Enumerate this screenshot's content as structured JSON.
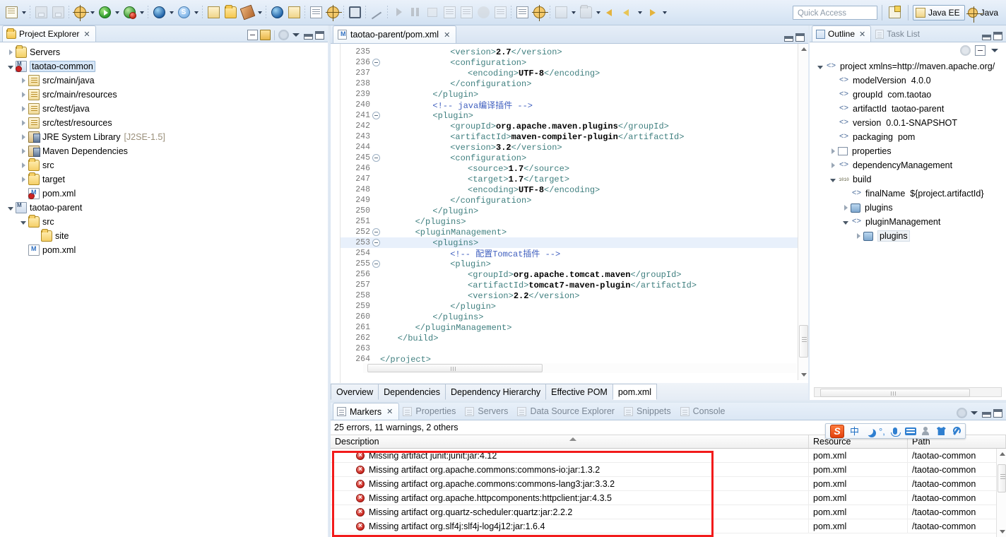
{
  "toolbar": {
    "quick_access_placeholder": "Quick Access",
    "perspectives": [
      {
        "label": "Java EE",
        "active": true
      },
      {
        "label": "Java",
        "active": false
      }
    ],
    "icons": [
      "new-wizard-icon",
      "new-wizard-dropdown",
      "save-icon",
      "save-all-icon",
      "debug-spider-icon",
      "debug-dropdown",
      "run-icon",
      "run-dropdown",
      "debug-bug-icon",
      "debug-bug-dropdown",
      "external-tools-icon",
      "external-tools-dropdown",
      "coverage-icon",
      "coverage-dropdown",
      "open-type-icon",
      "open-folder-icon",
      "brush-icon",
      "brush-dropdown",
      "web-browser-icon",
      "run-server-icon",
      "search-icon",
      "profile-icon",
      "terminal-icon",
      "toggle-breadcrumb-icon",
      "step-into-icon",
      "pause-icon",
      "stop-icon",
      "step-over-icon",
      "step-return-icon",
      "resume-icon",
      "drop-to-frame-icon",
      "next-annotation-icon",
      "previous-annotation-icon",
      "last-edit-icon",
      "last-edit-dropdown",
      "next-edit-icon",
      "next-edit-dropdown",
      "back-icon",
      "forward-icon",
      "forward-dropdown",
      "nav-forward-icon",
      "nav-forward-dropdown",
      "open-perspective-icon"
    ]
  },
  "project_explorer": {
    "title": "Project Explorer",
    "tools": [
      "collapse-all-icon",
      "link-with-editor-icon",
      "view-gear-icon",
      "view-menu-icon",
      "minimize-icon",
      "maximize-icon"
    ],
    "tree": [
      {
        "label": "Servers",
        "indent": 0,
        "twist": "closed",
        "icon": "server-folder-icon",
        "selected": false,
        "suffix": ""
      },
      {
        "label": "taotao-common",
        "indent": 0,
        "twist": "open",
        "icon": "maven-project-error-icon",
        "selected": true,
        "suffix": ""
      },
      {
        "label": "src/main/java",
        "indent": 1,
        "twist": "closed",
        "icon": "source-folder-icon",
        "selected": false,
        "suffix": ""
      },
      {
        "label": "src/main/resources",
        "indent": 1,
        "twist": "closed",
        "icon": "source-folder-icon",
        "selected": false,
        "suffix": ""
      },
      {
        "label": "src/test/java",
        "indent": 1,
        "twist": "closed",
        "icon": "source-folder-icon",
        "selected": false,
        "suffix": ""
      },
      {
        "label": "src/test/resources",
        "indent": 1,
        "twist": "closed",
        "icon": "source-folder-icon",
        "selected": false,
        "suffix": ""
      },
      {
        "label": "JRE System Library",
        "indent": 1,
        "twist": "closed",
        "icon": "jre-library-icon",
        "selected": false,
        "suffix": "[J2SE-1.5]"
      },
      {
        "label": "Maven Dependencies",
        "indent": 1,
        "twist": "closed",
        "icon": "jre-library-icon",
        "selected": false,
        "suffix": ""
      },
      {
        "label": "src",
        "indent": 1,
        "twist": "closed",
        "icon": "folder-icon",
        "selected": false,
        "suffix": ""
      },
      {
        "label": "target",
        "indent": 1,
        "twist": "closed",
        "icon": "folder-icon",
        "selected": false,
        "suffix": ""
      },
      {
        "label": "pom.xml",
        "indent": 1,
        "twist": "none",
        "icon": "pom-error-icon",
        "selected": false,
        "suffix": ""
      },
      {
        "label": "taotao-parent",
        "indent": 0,
        "twist": "open",
        "icon": "maven-project-icon",
        "selected": false,
        "suffix": ""
      },
      {
        "label": "src",
        "indent": 1,
        "twist": "open",
        "icon": "folder-icon",
        "selected": false,
        "suffix": ""
      },
      {
        "label": "site",
        "indent": 2,
        "twist": "none",
        "icon": "folder-icon",
        "selected": false,
        "suffix": ""
      },
      {
        "label": "pom.xml",
        "indent": 1,
        "twist": "none",
        "icon": "pom-icon",
        "selected": false,
        "suffix": ""
      }
    ]
  },
  "editor": {
    "tab_title": "taotao-parent/pom.xml",
    "tab_icon": "maven-pom-icon",
    "tools": [
      "minimize-icon",
      "maximize-icon"
    ],
    "bottom_tabs": [
      {
        "label": "Overview",
        "active": false
      },
      {
        "label": "Dependencies",
        "active": false
      },
      {
        "label": "Dependency Hierarchy",
        "active": false
      },
      {
        "label": "Effective POM",
        "active": false
      },
      {
        "label": "pom.xml",
        "active": true
      }
    ],
    "lines": [
      {
        "num": "235",
        "fold": false,
        "hl": false,
        "indent": 16,
        "text": "<version>2.7</version>"
      },
      {
        "num": "236",
        "fold": true,
        "hl": false,
        "indent": 16,
        "text": "<configuration>"
      },
      {
        "num": "237",
        "fold": false,
        "hl": false,
        "indent": 20,
        "text": "<encoding>UTF-8</encoding>"
      },
      {
        "num": "238",
        "fold": false,
        "hl": false,
        "indent": 16,
        "text": "</configuration>"
      },
      {
        "num": "239",
        "fold": false,
        "hl": false,
        "indent": 12,
        "text": "</plugin>"
      },
      {
        "num": "240",
        "fold": false,
        "hl": false,
        "indent": 12,
        "text": "<!-- java编译插件 -->"
      },
      {
        "num": "241",
        "fold": true,
        "hl": false,
        "indent": 12,
        "text": "<plugin>"
      },
      {
        "num": "242",
        "fold": false,
        "hl": false,
        "indent": 16,
        "text": "<groupId>org.apache.maven.plugins</groupId>"
      },
      {
        "num": "243",
        "fold": false,
        "hl": false,
        "indent": 16,
        "text": "<artifactId>maven-compiler-plugin</artifactId>"
      },
      {
        "num": "244",
        "fold": false,
        "hl": false,
        "indent": 16,
        "text": "<version>3.2</version>"
      },
      {
        "num": "245",
        "fold": true,
        "hl": false,
        "indent": 16,
        "text": "<configuration>"
      },
      {
        "num": "246",
        "fold": false,
        "hl": false,
        "indent": 20,
        "text": "<source>1.7</source>"
      },
      {
        "num": "247",
        "fold": false,
        "hl": false,
        "indent": 20,
        "text": "<target>1.7</target>"
      },
      {
        "num": "248",
        "fold": false,
        "hl": false,
        "indent": 20,
        "text": "<encoding>UTF-8</encoding>"
      },
      {
        "num": "249",
        "fold": false,
        "hl": false,
        "indent": 16,
        "text": "</configuration>"
      },
      {
        "num": "250",
        "fold": false,
        "hl": false,
        "indent": 12,
        "text": "</plugin>"
      },
      {
        "num": "251",
        "fold": false,
        "hl": false,
        "indent": 8,
        "text": "</plugins>"
      },
      {
        "num": "252",
        "fold": true,
        "hl": false,
        "indent": 8,
        "text": "<pluginManagement>"
      },
      {
        "num": "253",
        "fold": true,
        "hl": true,
        "indent": 12,
        "text": "<plugins>"
      },
      {
        "num": "254",
        "fold": false,
        "hl": false,
        "indent": 16,
        "text": "<!-- 配置Tomcat插件 -->"
      },
      {
        "num": "255",
        "fold": true,
        "hl": false,
        "indent": 16,
        "text": "<plugin>"
      },
      {
        "num": "256",
        "fold": false,
        "hl": false,
        "indent": 20,
        "text": "<groupId>org.apache.tomcat.maven</groupId>"
      },
      {
        "num": "257",
        "fold": false,
        "hl": false,
        "indent": 20,
        "text": "<artifactId>tomcat7-maven-plugin</artifactId>"
      },
      {
        "num": "258",
        "fold": false,
        "hl": false,
        "indent": 20,
        "text": "<version>2.2</version>"
      },
      {
        "num": "259",
        "fold": false,
        "hl": false,
        "indent": 16,
        "text": "</plugin>"
      },
      {
        "num": "260",
        "fold": false,
        "hl": false,
        "indent": 12,
        "text": "</plugins>"
      },
      {
        "num": "261",
        "fold": false,
        "hl": false,
        "indent": 8,
        "text": "</pluginManagement>"
      },
      {
        "num": "262",
        "fold": false,
        "hl": false,
        "indent": 4,
        "text": "</build>"
      },
      {
        "num": "263",
        "fold": false,
        "hl": false,
        "indent": 0,
        "text": ""
      },
      {
        "num": "264",
        "fold": false,
        "hl": false,
        "indent": 0,
        "text": "</project>"
      }
    ]
  },
  "outline": {
    "tabs": [
      {
        "label": "Outline",
        "icon": "outline-icon",
        "active": true
      },
      {
        "label": "Task List",
        "icon": "task-list-icon",
        "active": false
      }
    ],
    "tools": [
      "sort-icon",
      "collapse-all-icon",
      "view-menu-icon",
      "minimize-icon",
      "maximize-icon"
    ],
    "tree": [
      {
        "label": "project xmlns=http://maven.apache.org/",
        "value": "",
        "indent": 0,
        "twist": "open",
        "icon": "xml-tag-icon",
        "selected": false
      },
      {
        "label": "modelVersion",
        "value": "4.0.0",
        "indent": 1,
        "twist": "none",
        "icon": "xml-tag-icon",
        "selected": false
      },
      {
        "label": "groupId",
        "value": "com.taotao",
        "indent": 1,
        "twist": "none",
        "icon": "xml-tag-icon",
        "selected": false
      },
      {
        "label": "artifactId",
        "value": "taotao-parent",
        "indent": 1,
        "twist": "none",
        "icon": "xml-tag-icon",
        "selected": false
      },
      {
        "label": "version",
        "value": "0.0.1-SNAPSHOT",
        "indent": 1,
        "twist": "none",
        "icon": "xml-tag-icon",
        "selected": false
      },
      {
        "label": "packaging",
        "value": "pom",
        "indent": 1,
        "twist": "none",
        "icon": "xml-tag-icon",
        "selected": false
      },
      {
        "label": "properties",
        "value": "",
        "indent": 1,
        "twist": "closed",
        "icon": "properties-icon",
        "selected": false
      },
      {
        "label": "dependencyManagement",
        "value": "",
        "indent": 1,
        "twist": "closed",
        "icon": "xml-tag-icon",
        "selected": false
      },
      {
        "label": "build",
        "value": "",
        "indent": 1,
        "twist": "open",
        "icon": "binary-icon",
        "selected": false
      },
      {
        "label": "finalName",
        "value": "${project.artifactId}",
        "indent": 2,
        "twist": "none",
        "icon": "xml-tag-icon",
        "selected": false
      },
      {
        "label": "plugins",
        "value": "",
        "indent": 2,
        "twist": "closed",
        "icon": "plugins-icon",
        "selected": false
      },
      {
        "label": "pluginManagement",
        "value": "",
        "indent": 2,
        "twist": "open",
        "icon": "xml-tag-icon",
        "selected": false
      },
      {
        "label": "plugins",
        "value": "",
        "indent": 3,
        "twist": "closed",
        "icon": "plugins-icon",
        "selected": true
      }
    ]
  },
  "markers": {
    "tabs": [
      {
        "label": "Markers",
        "icon": "markers-icon",
        "active": true
      },
      {
        "label": "Properties",
        "icon": "properties-icon",
        "active": false
      },
      {
        "label": "Servers",
        "icon": "servers-icon",
        "active": false
      },
      {
        "label": "Data Source Explorer",
        "icon": "data-source-icon",
        "active": false
      },
      {
        "label": "Snippets",
        "icon": "snippets-icon",
        "active": false
      },
      {
        "label": "Console",
        "icon": "console-icon",
        "active": false
      }
    ],
    "tools": [
      "view-gear-icon",
      "view-menu-icon",
      "minimize-icon",
      "maximize-icon"
    ],
    "summary": "25 errors, 11 warnings, 2 others",
    "columns": [
      "Description",
      "Resource",
      "Path"
    ],
    "sorted_column": "Description",
    "rows": [
      {
        "description": "Missing artifact junit:junit:jar:4.12",
        "resource": "pom.xml",
        "path": "/taotao-common",
        "severity": "error"
      },
      {
        "description": "Missing artifact org.apache.commons:commons-io:jar:1.3.2",
        "resource": "pom.xml",
        "path": "/taotao-common",
        "severity": "error"
      },
      {
        "description": "Missing artifact org.apache.commons:commons-lang3:jar:3.3.2",
        "resource": "pom.xml",
        "path": "/taotao-common",
        "severity": "error"
      },
      {
        "description": "Missing artifact org.apache.httpcomponents:httpclient:jar:4.3.5",
        "resource": "pom.xml",
        "path": "/taotao-common",
        "severity": "error"
      },
      {
        "description": "Missing artifact org.quartz-scheduler:quartz:jar:2.2.2",
        "resource": "pom.xml",
        "path": "/taotao-common",
        "severity": "error"
      },
      {
        "description": "Missing artifact org.slf4j:slf4j-log4j12:jar:1.6.4",
        "resource": "pom.xml",
        "path": "/taotao-common",
        "severity": "error"
      }
    ],
    "highlight_color": "#f21b1b"
  },
  "ime_toolbar": {
    "name": "sogou-input-method-toolbar",
    "items": [
      "sogou-logo-icon",
      "chinese-mode-icon",
      "moon-icon",
      "punctuation-icon",
      "microphone-icon",
      "keyboard-icon",
      "user-icon",
      "skin-shirt-icon",
      "settings-wrench-icon"
    ],
    "mode_label": "中"
  }
}
